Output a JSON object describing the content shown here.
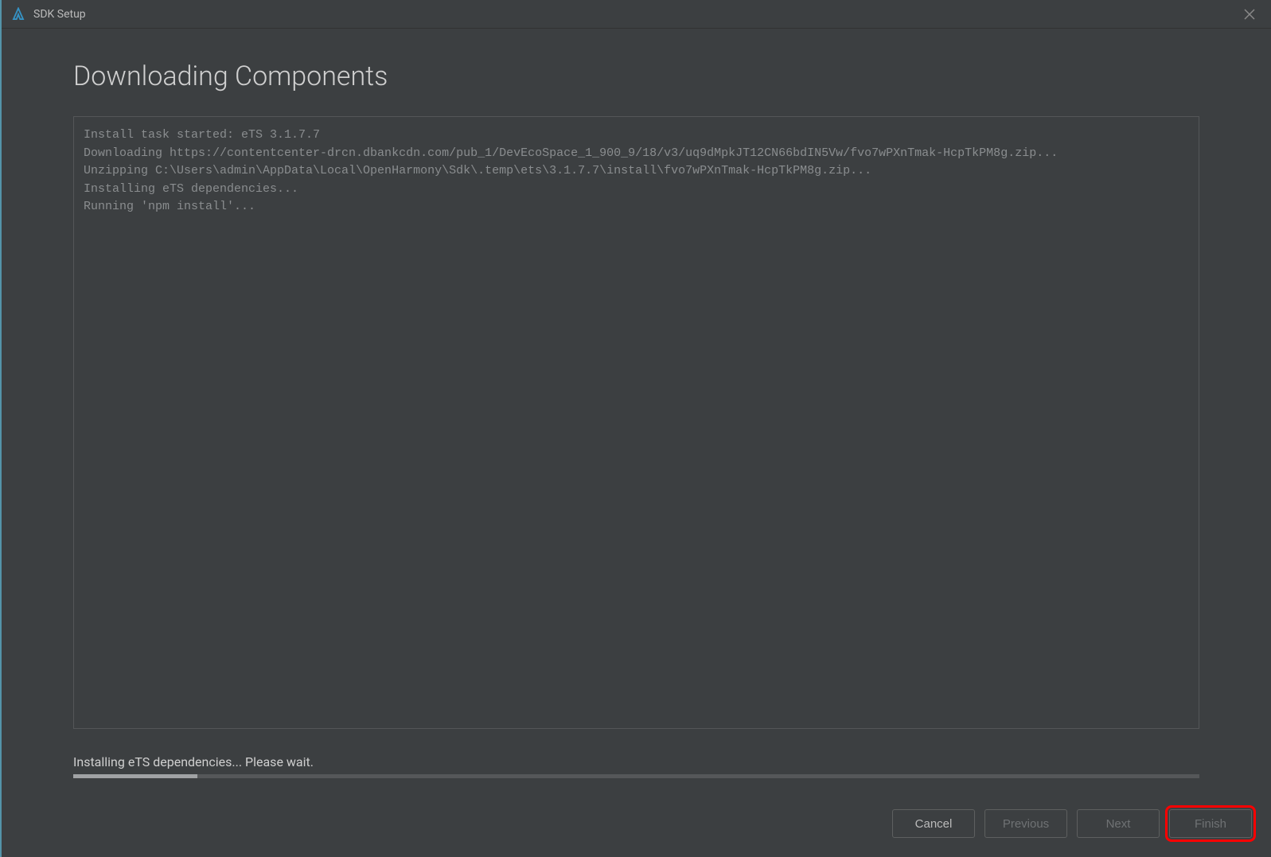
{
  "window": {
    "title": "SDK Setup"
  },
  "page": {
    "heading": "Downloading Components"
  },
  "log": {
    "lines": [
      "Install task started: eTS 3.1.7.7",
      "Downloading https://contentcenter-drcn.dbankcdn.com/pub_1/DevEcoSpace_1_900_9/18/v3/uq9dMpkJT12CN66bdIN5Vw/fvo7wPXnTmak-HcpTkPM8g.zip...",
      "Unzipping C:\\Users\\admin\\AppData\\Local\\OpenHarmony\\Sdk\\.temp\\ets\\3.1.7.7\\install\\fvo7wPXnTmak-HcpTkPM8g.zip...",
      "Installing eTS dependencies...",
      "Running 'npm install'..."
    ]
  },
  "status": {
    "text": "Installing eTS dependencies... Please wait.",
    "progress_percent": 11
  },
  "buttons": {
    "cancel": "Cancel",
    "previous": "Previous",
    "next": "Next",
    "finish": "Finish"
  }
}
